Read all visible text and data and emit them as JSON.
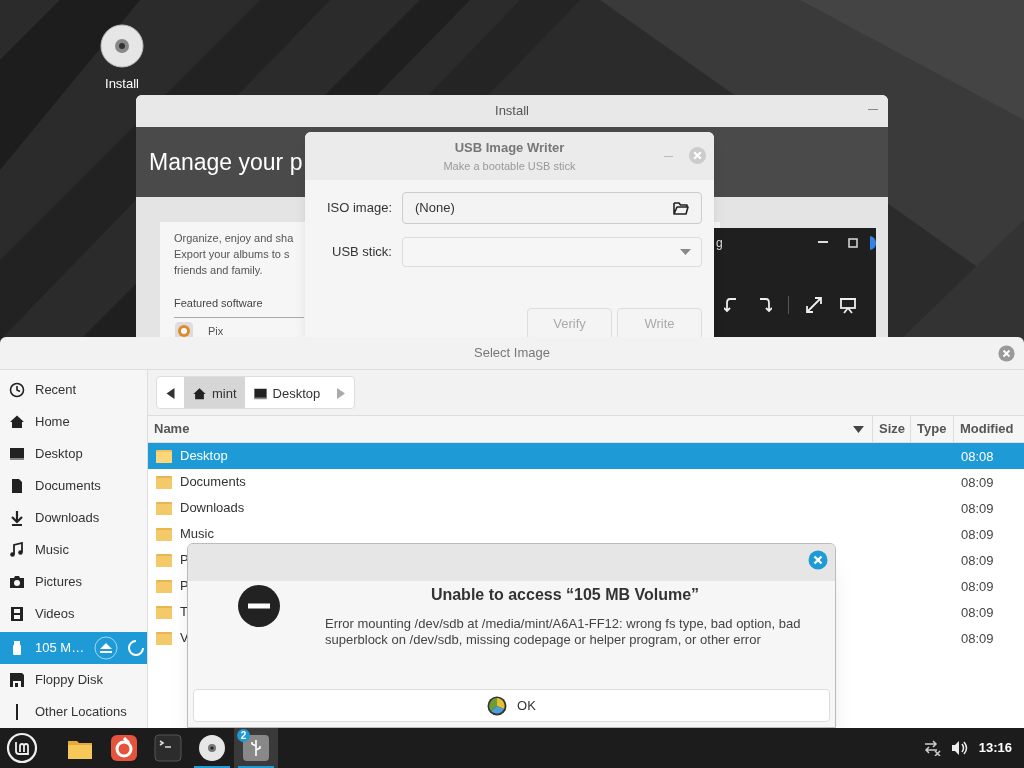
{
  "desktop": {
    "icons": [
      {
        "label": "Install"
      }
    ]
  },
  "install_window": {
    "title": "Install",
    "header": "Manage your p",
    "description": [
      "Organize, enjoy and sha",
      "Export your albums to s",
      "friends and family."
    ],
    "section": "Featured software",
    "apps": [
      {
        "name": "Pix"
      }
    ],
    "preview": {
      "title": "g"
    }
  },
  "usb_writer": {
    "title": "USB Image Writer",
    "subtitle": "Make a bootable USB stick",
    "fields": [
      {
        "label": "ISO image:",
        "kind": "file",
        "value": "(None)"
      },
      {
        "label": "USB stick:",
        "kind": "dropdown"
      }
    ],
    "buttons": [
      {
        "label": "Verify",
        "disabled": true
      },
      {
        "label": "Write",
        "disabled": true
      }
    ]
  },
  "select_image": {
    "title": "Select Image",
    "sidebar": [
      {
        "label": "Recent",
        "kind": "place",
        "selected": false
      },
      {
        "label": "Home",
        "kind": "place",
        "selected": false
      },
      {
        "label": "Desktop",
        "kind": "place",
        "selected": false
      },
      {
        "label": "Documents",
        "kind": "place",
        "selected": false
      },
      {
        "label": "Downloads",
        "kind": "place",
        "selected": false
      },
      {
        "label": "Music",
        "kind": "place",
        "selected": false
      },
      {
        "label": "Pictures",
        "kind": "place",
        "selected": false
      },
      {
        "label": "Videos",
        "kind": "place",
        "selected": false
      },
      {
        "label": "105 M…",
        "kind": "drive",
        "selected": true
      },
      {
        "label": "Floppy Disk",
        "kind": "drive",
        "selected": false
      },
      {
        "label": "Other Locations",
        "kind": "other",
        "selected": false
      }
    ],
    "path": [
      {
        "label": "mint",
        "selected": true
      },
      {
        "label": "Desktop",
        "selected": false
      }
    ],
    "columns": [
      "Name",
      "Size",
      "Type",
      "Modified"
    ],
    "rows": [
      {
        "name": "Desktop",
        "modified": "08:08",
        "selected": true
      },
      {
        "name": "Documents",
        "modified": "08:09",
        "selected": false
      },
      {
        "name": "Downloads",
        "modified": "08:09",
        "selected": false
      },
      {
        "name": "Music",
        "modified": "08:09",
        "selected": false
      },
      {
        "name": "P",
        "modified": "08:09",
        "selected": false
      },
      {
        "name": "P",
        "modified": "08:09",
        "selected": false
      },
      {
        "name": "T",
        "modified": "08:09",
        "selected": false
      },
      {
        "name": "V",
        "modified": "08:09",
        "selected": false
      }
    ]
  },
  "error_dialog": {
    "title": "Unable to access “105 MB Volume”",
    "message": "Error mounting /dev/sdb at /media/mint/A6A1-FF12: wrong fs type, bad option, bad superblock on /dev/sdb, missing codepage or helper program, or other error",
    "button": "OK"
  },
  "taskbar": {
    "apps": [
      {
        "running": false,
        "selected": false
      },
      {
        "running": false,
        "selected": false
      },
      {
        "running": false,
        "selected": false
      },
      {
        "running": true,
        "selected": false
      },
      {
        "running": true,
        "selected": true,
        "badge": "2"
      }
    ],
    "clock": "13:16"
  }
}
